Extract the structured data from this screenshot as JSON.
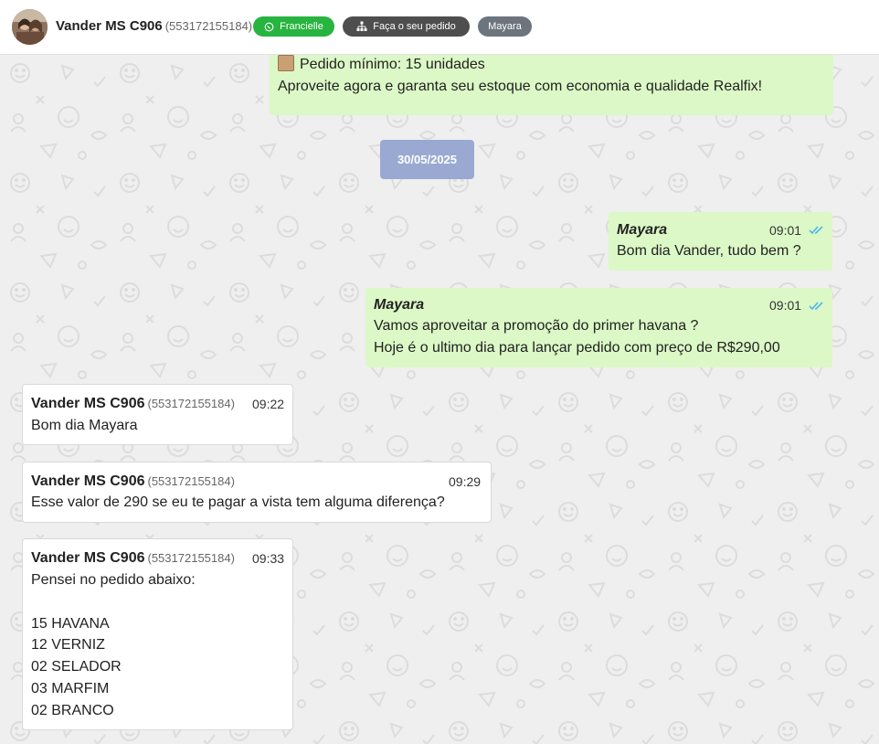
{
  "header": {
    "contact_name": "Vander MS C906",
    "contact_phone": "(553172155184)",
    "tag_agent": "Francielle",
    "tag_order": "Faça o seu pedido",
    "tag_user": "Mayara",
    "avatar_icon": "avatar-photo"
  },
  "chat": {
    "top_message": {
      "line_1": "Pedido mínimo: 15 unidades",
      "line_2": "Aproveite agora e garanta seu estoque com economia e qualidade Realfix!",
      "icon": "package-box-icon"
    },
    "date_separator": "30/05/2025",
    "messages": [
      {
        "sender": "Mayara",
        "time": "09:01",
        "lines": [
          "Bom dia Vander, tudo bem ?"
        ],
        "status": "read"
      },
      {
        "sender": "Mayara",
        "time": "09:01",
        "lines": [
          "Vamos aproveitar a promoção do primer havana ?",
          "Hoje é o ultimo dia para lançar pedido com preço de R$290,00"
        ],
        "status": "read"
      },
      {
        "sender": "Vander MS C906",
        "phone": "(553172155184)",
        "time": "09:22",
        "lines": [
          "Bom dia Mayara"
        ]
      },
      {
        "sender": "Vander MS C906",
        "phone": "(553172155184)",
        "time": "09:29",
        "lines": [
          "Esse valor de 290 se eu te pagar a vista tem alguma diferença?"
        ]
      },
      {
        "sender": "Vander MS C906",
        "phone": "(553172155184)",
        "time": "09:33",
        "lines": [
          "Pensei no pedido abaixo:",
          "",
          "15 HAVANA",
          "12 VERNIZ",
          "02 SELADOR",
          "03 MARFIM",
          "02 BRANCO"
        ]
      }
    ]
  },
  "colors": {
    "outgoing_bubble": "#dbf8c6",
    "incoming_bubble": "#ffffff",
    "date_chip": "#99a9d2",
    "read_ticks": "#4fb6ec",
    "tag_green": "#27b43f",
    "tag_dark": "#4e4e4e",
    "tag_grey": "#6c757d"
  }
}
